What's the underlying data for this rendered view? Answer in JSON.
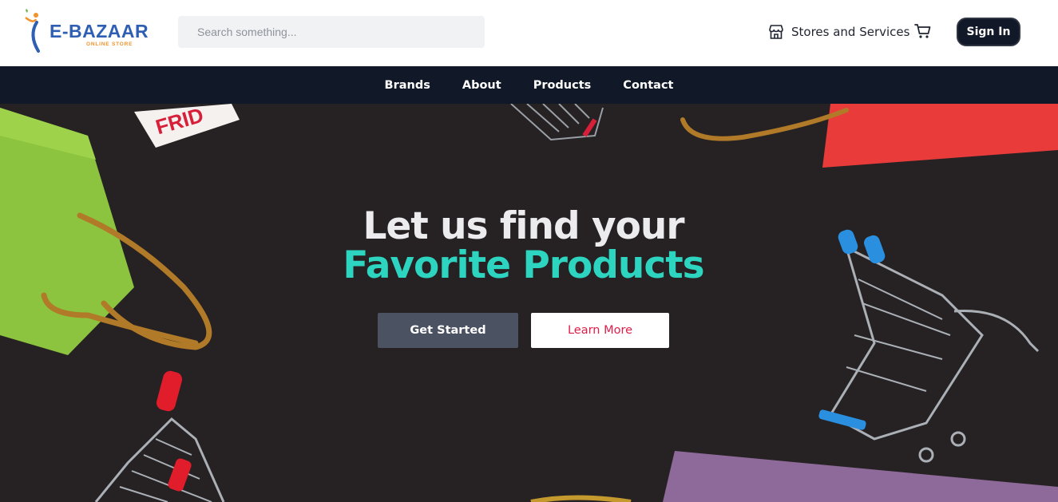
{
  "header": {
    "logo_name": "E-BAZAAR",
    "logo_tagline": "ONLINE STORE",
    "search_placeholder": "Search something...",
    "stores_label": "Stores and Services",
    "signin_label": "Sign In"
  },
  "nav": {
    "items": [
      "Brands",
      "About",
      "Products",
      "Contact"
    ]
  },
  "hero": {
    "title_line1": "Let us find your",
    "title_line2": "Favorite Products",
    "primary_button": "Get Started",
    "secondary_button": "Learn More"
  },
  "colors": {
    "nav_bg": "#111827",
    "accent_teal": "#2dd4bf",
    "accent_red": "#e11d48",
    "button_gray": "#4b5262",
    "logo_blue": "#2f5fb3",
    "logo_orange": "#f0932b"
  },
  "icons": {
    "stores": "store-icon",
    "cart": "cart-icon"
  }
}
